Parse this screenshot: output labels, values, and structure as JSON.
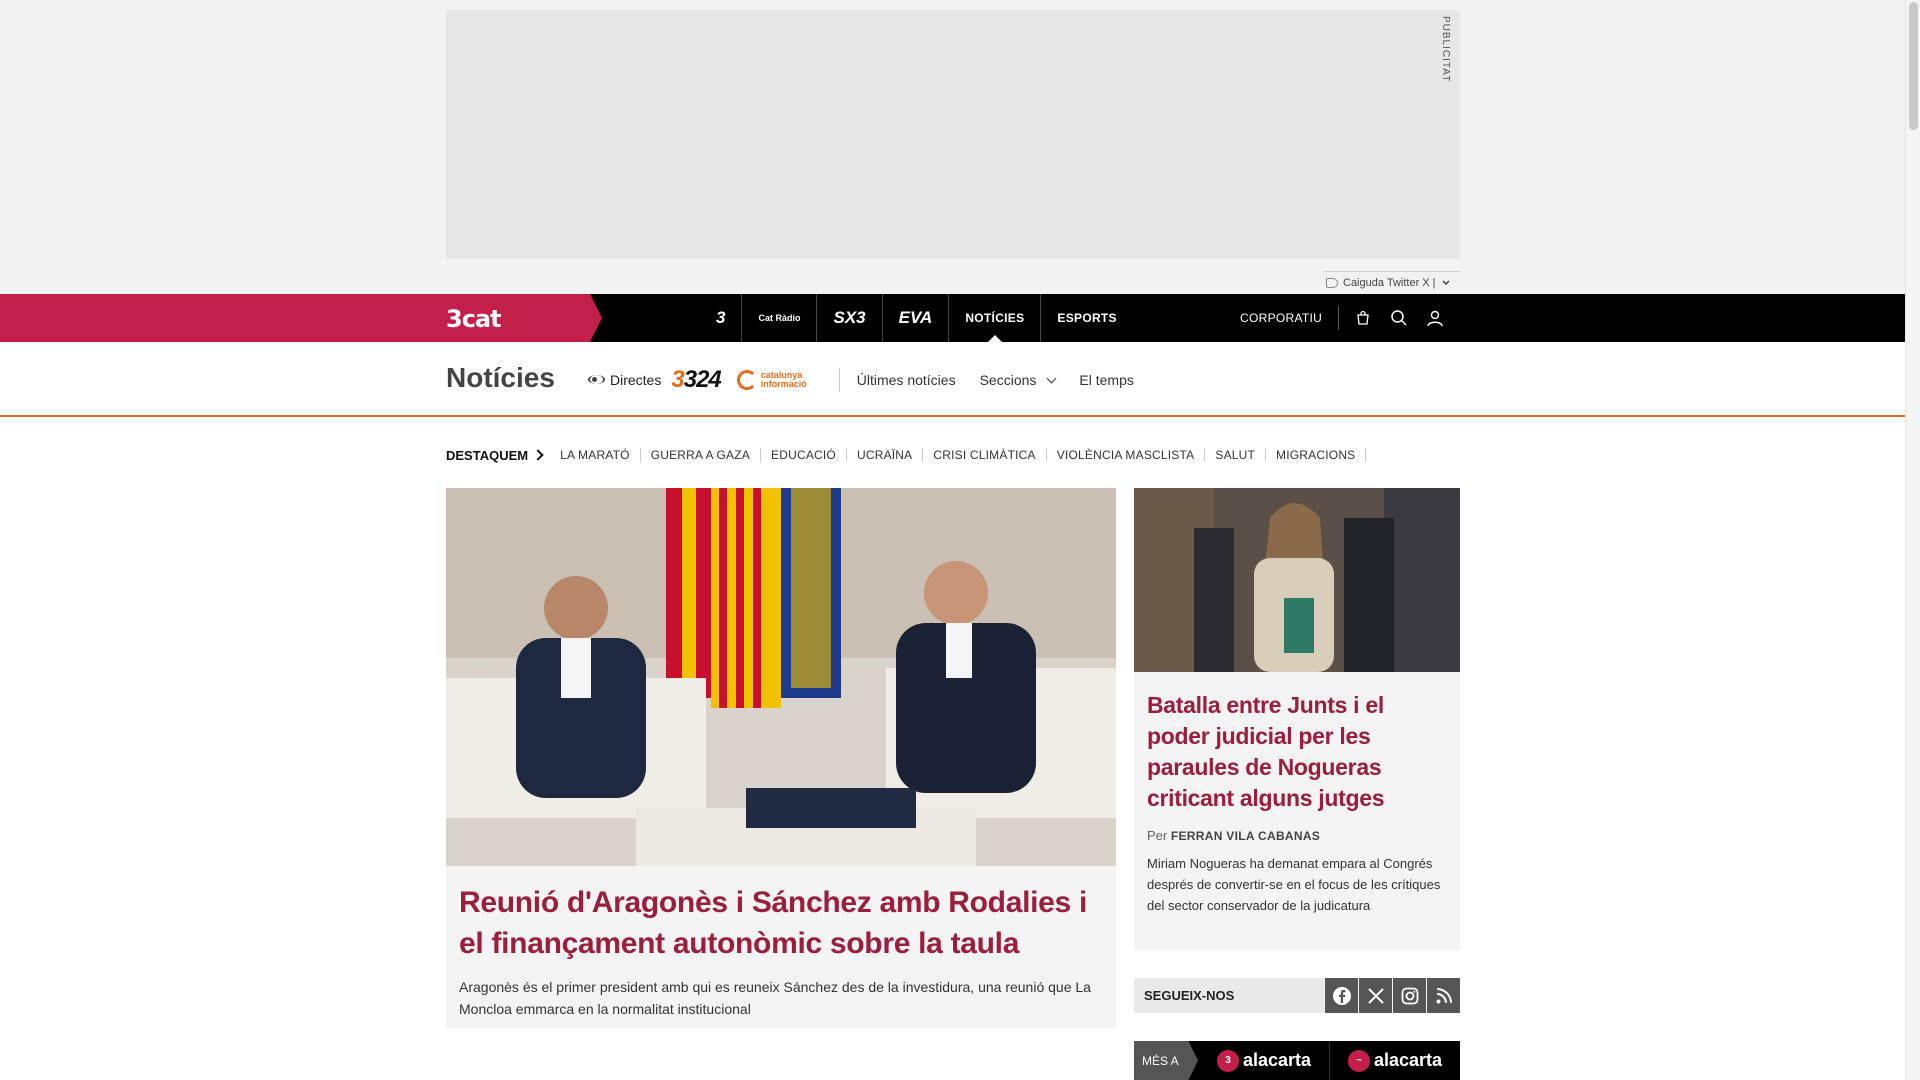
{
  "ad": {
    "label": "PUBLICITAT",
    "meta_text": "Caiguda Twitter X |"
  },
  "topnav": {
    "brand": "3cat",
    "channels": [
      "3",
      "Cat Ràdio",
      "SX3",
      "EVA"
    ],
    "links": [
      "NOTÍCIES",
      "ESPORTS"
    ],
    "corporate": "CORPORATIU"
  },
  "section": {
    "title": "Notícies",
    "directes": "Directes",
    "logo_324": "324",
    "logo_cat": "catalunya informació",
    "links": [
      "Últimes notícies",
      "Seccions",
      "El temps"
    ]
  },
  "highlights": {
    "heading": "DESTAQUEM",
    "items": [
      "LA MARATÓ",
      "GUERRA A GAZA",
      "EDUCACIÓ",
      "UCRAÏNA",
      "CRISI CLIMÀTICA",
      "VIOLÈNCIA MASCLISTA",
      "SALUT",
      "MIGRACIONS"
    ]
  },
  "main_article": {
    "title": "Reunió d'Aragonès i Sánchez amb Rodalies i el finançament autonòmic sobre la taula",
    "summary": "Aragonès és el primer president amb qui es reuneix Sánchez des de la investidura, una reunió que La Moncloa emmarca en la normalitat institucional"
  },
  "side_article": {
    "title": "Batalla entre Junts i el poder judicial per les paraules de Nogueras criticant alguns jutges",
    "author_prefix": "Per",
    "author": "FERRAN VILA CABANAS",
    "summary": "Miriam Nogueras ha demanat empara al Congrés després de convertir-se en el focus de les crítiques del sector conservador de la judicatura"
  },
  "follow": {
    "label": "SEGUEIX-NOS",
    "networks": [
      "facebook-icon",
      "x-icon",
      "instagram-icon",
      "rss-icon"
    ]
  },
  "alacarta": {
    "label": "MÉS A",
    "items": [
      "alacarta",
      "alacarta"
    ],
    "badges": [
      "3",
      "~"
    ]
  },
  "colors": {
    "brand": "#c41e4a",
    "headline": "#9c1e3c",
    "accent": "#e46a1d"
  }
}
